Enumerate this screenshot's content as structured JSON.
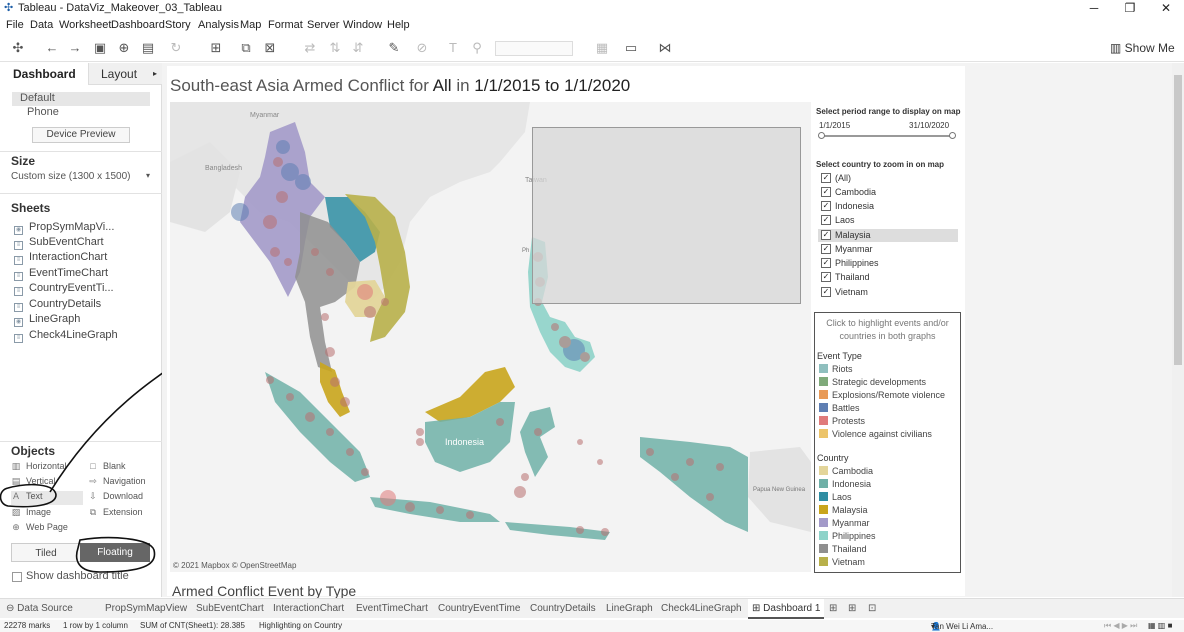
{
  "window": {
    "title": "Tableau - DataViz_Makeover_03_Tableau",
    "controls": [
      "─",
      "❐",
      "✕"
    ]
  },
  "menu": [
    "File",
    "Data",
    "Worksheet",
    "Dashboard",
    "Story",
    "Analysis",
    "Map",
    "Format",
    "Server",
    "Window",
    "Help"
  ],
  "toolbar": {
    "show_me": "Show Me"
  },
  "left_pane": {
    "tabs": {
      "dashboard": "Dashboard",
      "layout": "Layout"
    },
    "device": {
      "default": "Default",
      "phone": "Phone",
      "preview_button": "Device Preview"
    },
    "size": {
      "title": "Size",
      "value": "Custom size (1300 x 1500)"
    },
    "sheets_title": "Sheets",
    "sheets": [
      "PropSymMapVi...",
      "SubEventChart",
      "InteractionChart",
      "EventTimeChart",
      "CountryEventTi...",
      "CountryDetails",
      "LineGraph",
      "Check4LineGraph"
    ],
    "objects_title": "Objects",
    "objects_left": [
      "Horizontal",
      "Vertical",
      "Text",
      "Image",
      "Web Page"
    ],
    "objects_right": [
      "Blank",
      "Navigation",
      "Download",
      "Extension"
    ],
    "tiled": "Tiled",
    "floating": "Floating",
    "show_title": "Show dashboard title"
  },
  "dashboard": {
    "title_prefix": "South-east Asia Armed Conflict for ",
    "title_all": "All",
    "title_in": " in ",
    "title_range": "1/1/2015 to 1/1/2020",
    "map_attribution": "© 2021 Mapbox © OpenStreetMap",
    "subtitle": "Armed Conflict Event by Type",
    "map_labels": {
      "myanmar": "Myanmar",
      "bangladesh": "Bangladesh",
      "taiwan": "Taiwan",
      "indonesia": "Indonesia",
      "papua": "Papua New\nGuinea",
      "ph": "Ph"
    }
  },
  "filters": {
    "period_label": "Select period range to display on map",
    "period_start": "1/1/2015",
    "period_end": "31/10/2020",
    "country_label": "Select country to zoom in on map",
    "countries": [
      "(All)",
      "Cambodia",
      "Indonesia",
      "Laos",
      "Malaysia",
      "Myanmar",
      "Philippines",
      "Thailand",
      "Vietnam"
    ],
    "highlighted": "Malaysia"
  },
  "legend": {
    "hint": "Click to highlight events and/or countries in both graphs",
    "event_type_title": "Event Type",
    "event_types": [
      {
        "label": "Riots",
        "color": "#8fbfbe"
      },
      {
        "label": "Strategic developments",
        "color": "#7faa7a"
      },
      {
        "label": "Explosions/Remote violence",
        "color": "#e89a57"
      },
      {
        "label": "Battles",
        "color": "#5f7fb3"
      },
      {
        "label": "Protests",
        "color": "#e07b7b"
      },
      {
        "label": "Violence against civilians",
        "color": "#ecc46a"
      }
    ],
    "country_title": "Country",
    "countries": [
      {
        "label": "Cambodia",
        "color": "#e3d59a"
      },
      {
        "label": "Indonesia",
        "color": "#6fb0a7"
      },
      {
        "label": "Laos",
        "color": "#2f8ea3"
      },
      {
        "label": "Malaysia",
        "color": "#c9a51c"
      },
      {
        "label": "Myanmar",
        "color": "#a39ac9"
      },
      {
        "label": "Philippines",
        "color": "#8ed3c9"
      },
      {
        "label": "Thailand",
        "color": "#8f8f8f"
      },
      {
        "label": "Vietnam",
        "color": "#b8b04a"
      }
    ]
  },
  "sheet_tabs": [
    "Data Source",
    "PropSymMapView",
    "SubEventChart",
    "InteractionChart",
    "EventTimeChart",
    "CountryEventTime",
    "CountryDetails",
    "LineGraph",
    "Check4LineGraph",
    "Dashboard 1"
  ],
  "status": {
    "marks": "22278 marks",
    "rows": "1 row by 1 column",
    "sum": "SUM of CNT(Sheet1): 28.385",
    "highlight": "Highlighting on Country",
    "user": "Tan Wei Li Ama..."
  }
}
